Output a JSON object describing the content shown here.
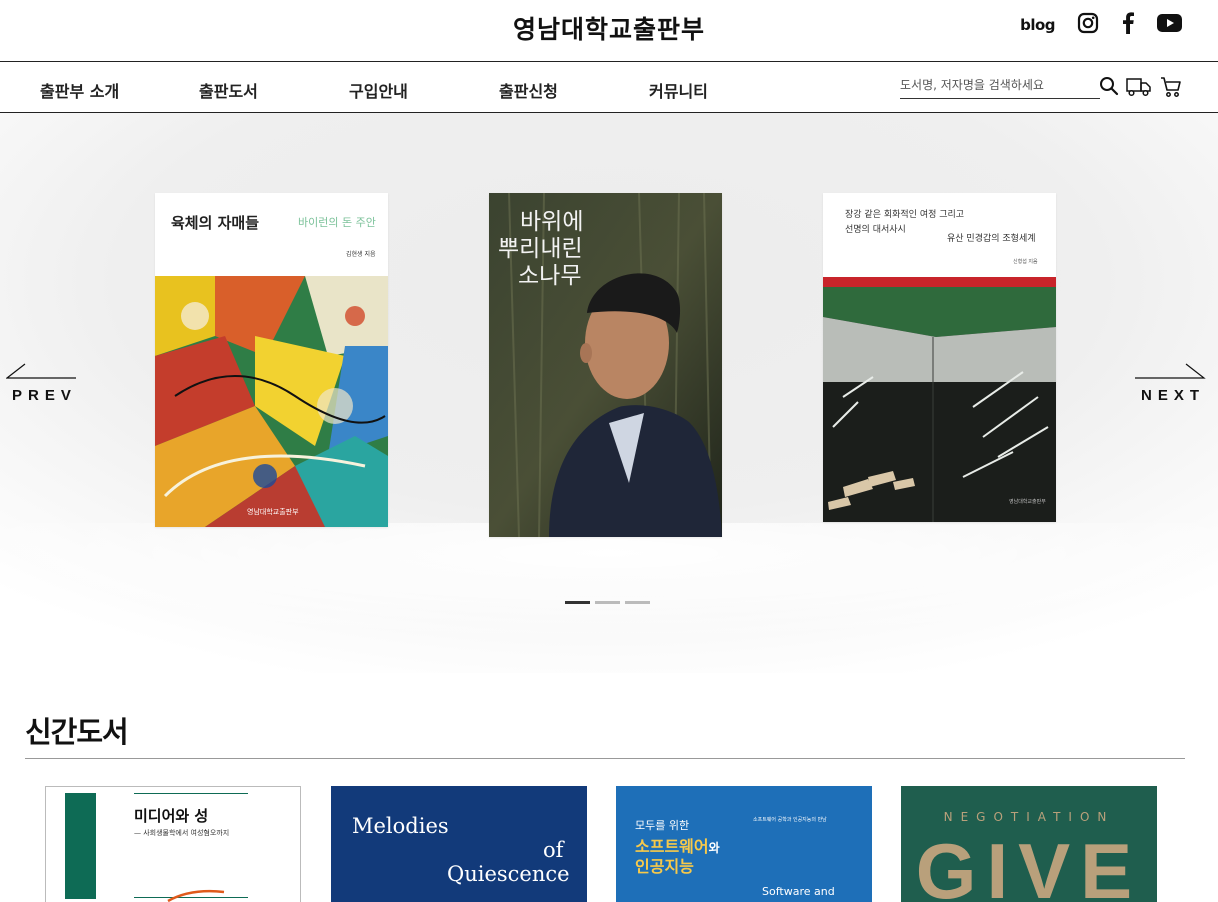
{
  "header": {
    "logo_text": "영남대학교출판부",
    "blog_label": "blog"
  },
  "nav": {
    "items": [
      "출판부 소개",
      "출판도서",
      "구입안내",
      "출판신청",
      "커뮤니티"
    ],
    "search_placeholder": "도서명, 저자명을 검색하세요"
  },
  "slider": {
    "prev_label": "PREV",
    "next_label": "NEXT",
    "active_index": 0,
    "dot_count": 3,
    "books": [
      {
        "title": "육체의 자매들",
        "subtitle": "바이런의 돈 주안",
        "author": "김현생 지음",
        "publisher": "영남대학교출판부"
      },
      {
        "title_lines": [
          "바위에",
          "뿌리내린",
          "소나무"
        ]
      },
      {
        "title_lines": [
          "장강 같은 회화적인 여정 그리고",
          "선명의 대서사시"
        ],
        "subtitle": "유산 민경갑의 조형세계",
        "author": "신형섭 지음",
        "publisher": "영남대학교출판부"
      }
    ]
  },
  "new_books": {
    "heading": "신간도서",
    "books": [
      {
        "title": "미디어와 성",
        "subtitle": "— 사회생물학에서 여성혐오까지"
      },
      {
        "title_lines": [
          "Melodies",
          "of",
          "Quiescence"
        ]
      },
      {
        "kicker": "모두를 위한",
        "title_a": "소프트웨어",
        "title_a_suffix": "와",
        "title_b": "인공지능",
        "top_note": "소프트웨어 공학과 인공지능의 만남",
        "bottom": "Software and"
      },
      {
        "kicker": "NEGOTIATION",
        "title": "GIVE"
      }
    ]
  },
  "colors": {
    "text_dark": "#111111",
    "hero_bg": "#efefef",
    "melodies_blue": "#123a7a",
    "sw_blue": "#1e6fb8",
    "negotiation_green": "#1f5e4e",
    "media_green": "#0e6b55",
    "give_gold": "#b9a07b"
  }
}
